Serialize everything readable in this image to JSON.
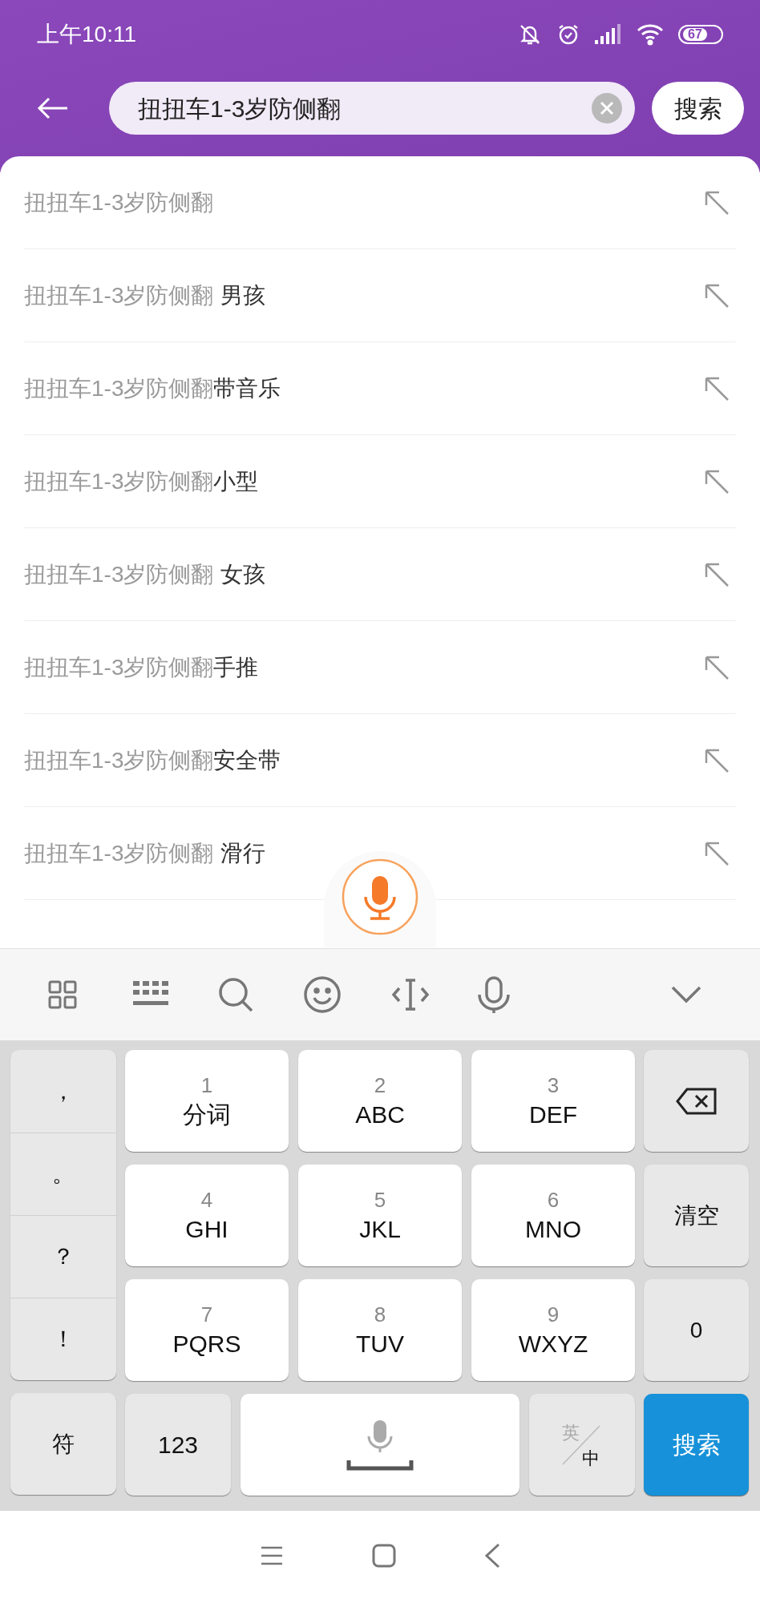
{
  "status_bar": {
    "time": "上午10:11",
    "battery": "67"
  },
  "search": {
    "value": "扭扭车1-3岁防侧翻",
    "button": "搜索"
  },
  "suggestions": [
    {
      "query": "扭扭车1-3岁防侧翻"
    },
    {
      "query": "扭扭车1-3岁防侧翻",
      "suffix": "男孩",
      "spaced": true
    },
    {
      "query": "扭扭车1-3岁防侧翻",
      "suffix": "带音乐",
      "spaced": false
    },
    {
      "query": "扭扭车1-3岁防侧翻",
      "suffix": "小型",
      "spaced": false
    },
    {
      "query": "扭扭车1-3岁防侧翻",
      "suffix": "女孩",
      "spaced": true
    },
    {
      "query": "扭扭车1-3岁防侧翻",
      "suffix": "手推",
      "spaced": false
    },
    {
      "query": "扭扭车1-3岁防侧翻",
      "suffix": "安全带",
      "spaced": false
    },
    {
      "query": "扭扭车1-3岁防侧翻",
      "suffix": "滑行",
      "spaced": true
    }
  ],
  "keyboard": {
    "punctuation": [
      "，",
      "。",
      "？",
      "！"
    ],
    "keys": [
      {
        "digit": "1",
        "letters": "分词"
      },
      {
        "digit": "2",
        "letters": "ABC"
      },
      {
        "digit": "3",
        "letters": "DEF"
      },
      {
        "digit": "4",
        "letters": "GHI"
      },
      {
        "digit": "5",
        "letters": "JKL"
      },
      {
        "digit": "6",
        "letters": "MNO"
      },
      {
        "digit": "7",
        "letters": "PQRS"
      },
      {
        "digit": "8",
        "letters": "TUV"
      },
      {
        "digit": "9",
        "letters": "WXYZ"
      }
    ],
    "clear": "清空",
    "zero": "0",
    "symbols": "符",
    "numbers": "123",
    "lang_en": "英",
    "lang_zh": "中",
    "enter": "搜索"
  }
}
